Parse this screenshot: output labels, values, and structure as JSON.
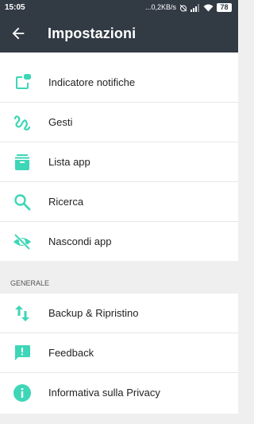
{
  "status": {
    "time": "15:05",
    "network": "...0,2KB/s",
    "battery": "78",
    "icons": [
      "alarm-off-icon",
      "signal-icon",
      "wifi-icon",
      "battery-icon"
    ]
  },
  "header": {
    "title": "Impostazioni",
    "back_icon": "arrow-back-icon"
  },
  "colors": {
    "accent": "#3ed6b7",
    "appbar": "#323a44",
    "background": "#efefef"
  },
  "main": {
    "items": [
      {
        "label": "Indicatore notifiche",
        "icon": "notification-badge-icon"
      },
      {
        "label": "Gesti",
        "icon": "gesture-icon"
      },
      {
        "label": "Lista app",
        "icon": "archive-box-icon"
      },
      {
        "label": "Ricerca",
        "icon": "search-icon"
      },
      {
        "label": "Nascondi app",
        "icon": "eye-off-icon"
      }
    ]
  },
  "general": {
    "header": "GENERALE",
    "items": [
      {
        "label": "Backup & Ripristino",
        "icon": "swap-vertical-icon"
      },
      {
        "label": "Feedback",
        "icon": "feedback-icon"
      },
      {
        "label": "Informativa sulla Privacy",
        "icon": "info-icon"
      }
    ]
  }
}
